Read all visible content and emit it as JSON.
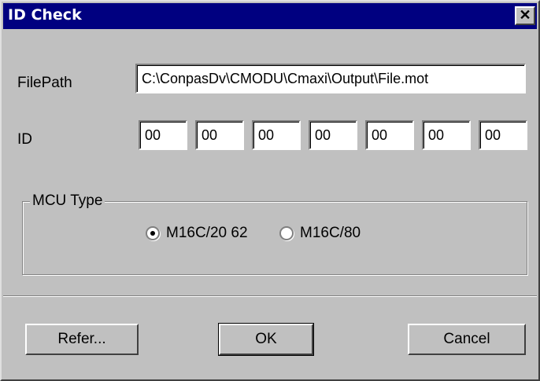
{
  "window": {
    "title": "ID Check",
    "close_glyph": "✕"
  },
  "filepath": {
    "label": "FilePath",
    "value": "C:\\ConpasDv\\CMODU\\Cmaxi\\Output\\File.mot"
  },
  "id": {
    "label": "ID",
    "values": [
      "00",
      "00",
      "00",
      "00",
      "00",
      "00",
      "00"
    ]
  },
  "mcu": {
    "group_label": "MCU Type",
    "options": [
      {
        "label": "M16C/20 62",
        "selected": true
      },
      {
        "label": "M16C/80",
        "selected": false
      }
    ]
  },
  "buttons": {
    "refer": "Refer...",
    "ok": "OK",
    "cancel": "Cancel"
  }
}
